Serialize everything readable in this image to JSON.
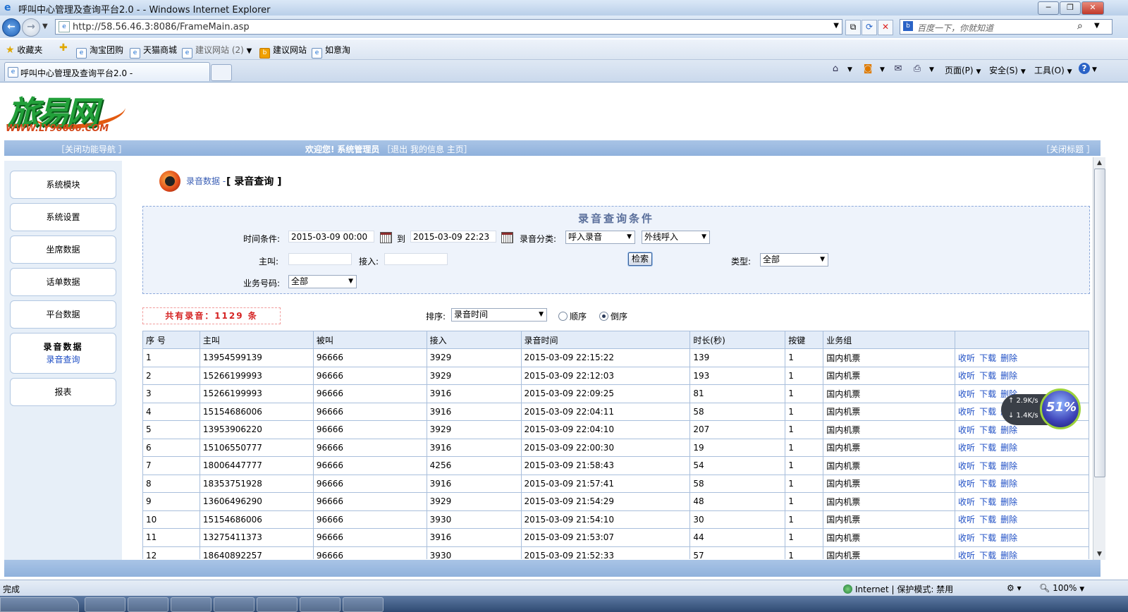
{
  "window": {
    "title": "呼叫中心管理及查询平台2.0 -   - Windows Internet Explorer",
    "minimize": "─",
    "restore": "❐",
    "close": "✕"
  },
  "address": {
    "url": "http://58.56.46.3:8086/FrameMain.asp",
    "search_placeholder": "百度一下，你就知道"
  },
  "favbar": {
    "favorites": "收藏夹",
    "items": [
      "淘宝团购",
      "天猫商城",
      "建议网站 (2)",
      "建议网站",
      "如意淘"
    ]
  },
  "tab": {
    "title": "呼叫中心管理及查询平台2.0 -"
  },
  "commands": {
    "page": "页面(P)",
    "safety": "安全(S)",
    "tools": "工具(O)"
  },
  "logo": {
    "word": "旅易网",
    "url": "WWW.LY96666.COM"
  },
  "topbar": {
    "close_nav": "［关闭功能导航 ］",
    "welcome": "欢迎您!",
    "user": "系统管理员",
    "links": "［退出  我的信息  主页］",
    "close_title": "［关闭标题 ］"
  },
  "sidebar": {
    "items": [
      "系统模块",
      "系统设置",
      "坐席数据",
      "话单数据",
      "平台数据"
    ],
    "active_header": "录音数据",
    "active_sub": "录音查询",
    "last": "报表"
  },
  "breadcrumb": {
    "parent": "录音数据",
    "sep": " - ",
    "current": "[ 录音查询 ]"
  },
  "query": {
    "title": "录音查询条件",
    "time_label": "时间条件:",
    "time_from": "2015-03-09 00:00",
    "to_label": "到",
    "time_to": "2015-03-09 22:23",
    "category_label": "录音分类:",
    "category_value": "呼入录音",
    "category2_value": "外线呼入",
    "caller_label": "主叫:",
    "caller_value": "",
    "callee_label": "接入:",
    "callee_value": "",
    "search_button": "检索",
    "type_label": "类型:",
    "type_value": "全部",
    "biz_label": "业务号码:",
    "biz_value": "全部"
  },
  "results": {
    "count_text": "共有录音：1129 条",
    "sort_label": "排序:",
    "sort_value": "录音时间",
    "asc_label": "顺序",
    "desc_label": "倒序",
    "sort_direction": "desc"
  },
  "table": {
    "headers": [
      "序 号",
      "主叫",
      "被叫",
      "接入",
      "录音时间",
      "时长(秒)",
      "按键",
      "业务组",
      ""
    ],
    "ops": [
      "收听",
      "下载",
      "删除"
    ],
    "rows": [
      [
        "1",
        "13954599139",
        "96666",
        "3929",
        "2015-03-09 22:15:22",
        "139",
        "1",
        "国内机票"
      ],
      [
        "2",
        "15266199993",
        "96666",
        "3929",
        "2015-03-09 22:12:03",
        "193",
        "1",
        "国内机票"
      ],
      [
        "3",
        "15266199993",
        "96666",
        "3916",
        "2015-03-09 22:09:25",
        "81",
        "1",
        "国内机票"
      ],
      [
        "4",
        "15154686006",
        "96666",
        "3916",
        "2015-03-09 22:04:11",
        "58",
        "1",
        "国内机票"
      ],
      [
        "5",
        "13953906220",
        "96666",
        "3929",
        "2015-03-09 22:04:10",
        "207",
        "1",
        "国内机票"
      ],
      [
        "6",
        "15106550777",
        "96666",
        "3916",
        "2015-03-09 22:00:30",
        "19",
        "1",
        "国内机票"
      ],
      [
        "7",
        "18006447777",
        "96666",
        "4256",
        "2015-03-09 21:58:43",
        "54",
        "1",
        "国内机票"
      ],
      [
        "8",
        "18353751928",
        "96666",
        "3916",
        "2015-03-09 21:57:41",
        "58",
        "1",
        "国内机票"
      ],
      [
        "9",
        "13606496290",
        "96666",
        "3929",
        "2015-03-09 21:54:29",
        "48",
        "1",
        "国内机票"
      ],
      [
        "10",
        "15154686006",
        "96666",
        "3930",
        "2015-03-09 21:54:10",
        "30",
        "1",
        "国内机票"
      ],
      [
        "11",
        "13275411373",
        "96666",
        "3916",
        "2015-03-09 21:53:07",
        "44",
        "1",
        "国内机票"
      ],
      [
        "12",
        "18640892257",
        "96666",
        "3930",
        "2015-03-09 21:52:33",
        "57",
        "1",
        "国内机票"
      ]
    ]
  },
  "speed_widget": {
    "up": "↑ 2.9K/s",
    "down": "↓ 1.4K/s",
    "percent": "51%"
  },
  "status": {
    "text": "完成",
    "zone": "Internet | 保护模式: 禁用",
    "zoom": "100%"
  },
  "colors": {
    "accent": "#8fb1dc",
    "link": "#1f4fc5",
    "count": "#d52323"
  }
}
